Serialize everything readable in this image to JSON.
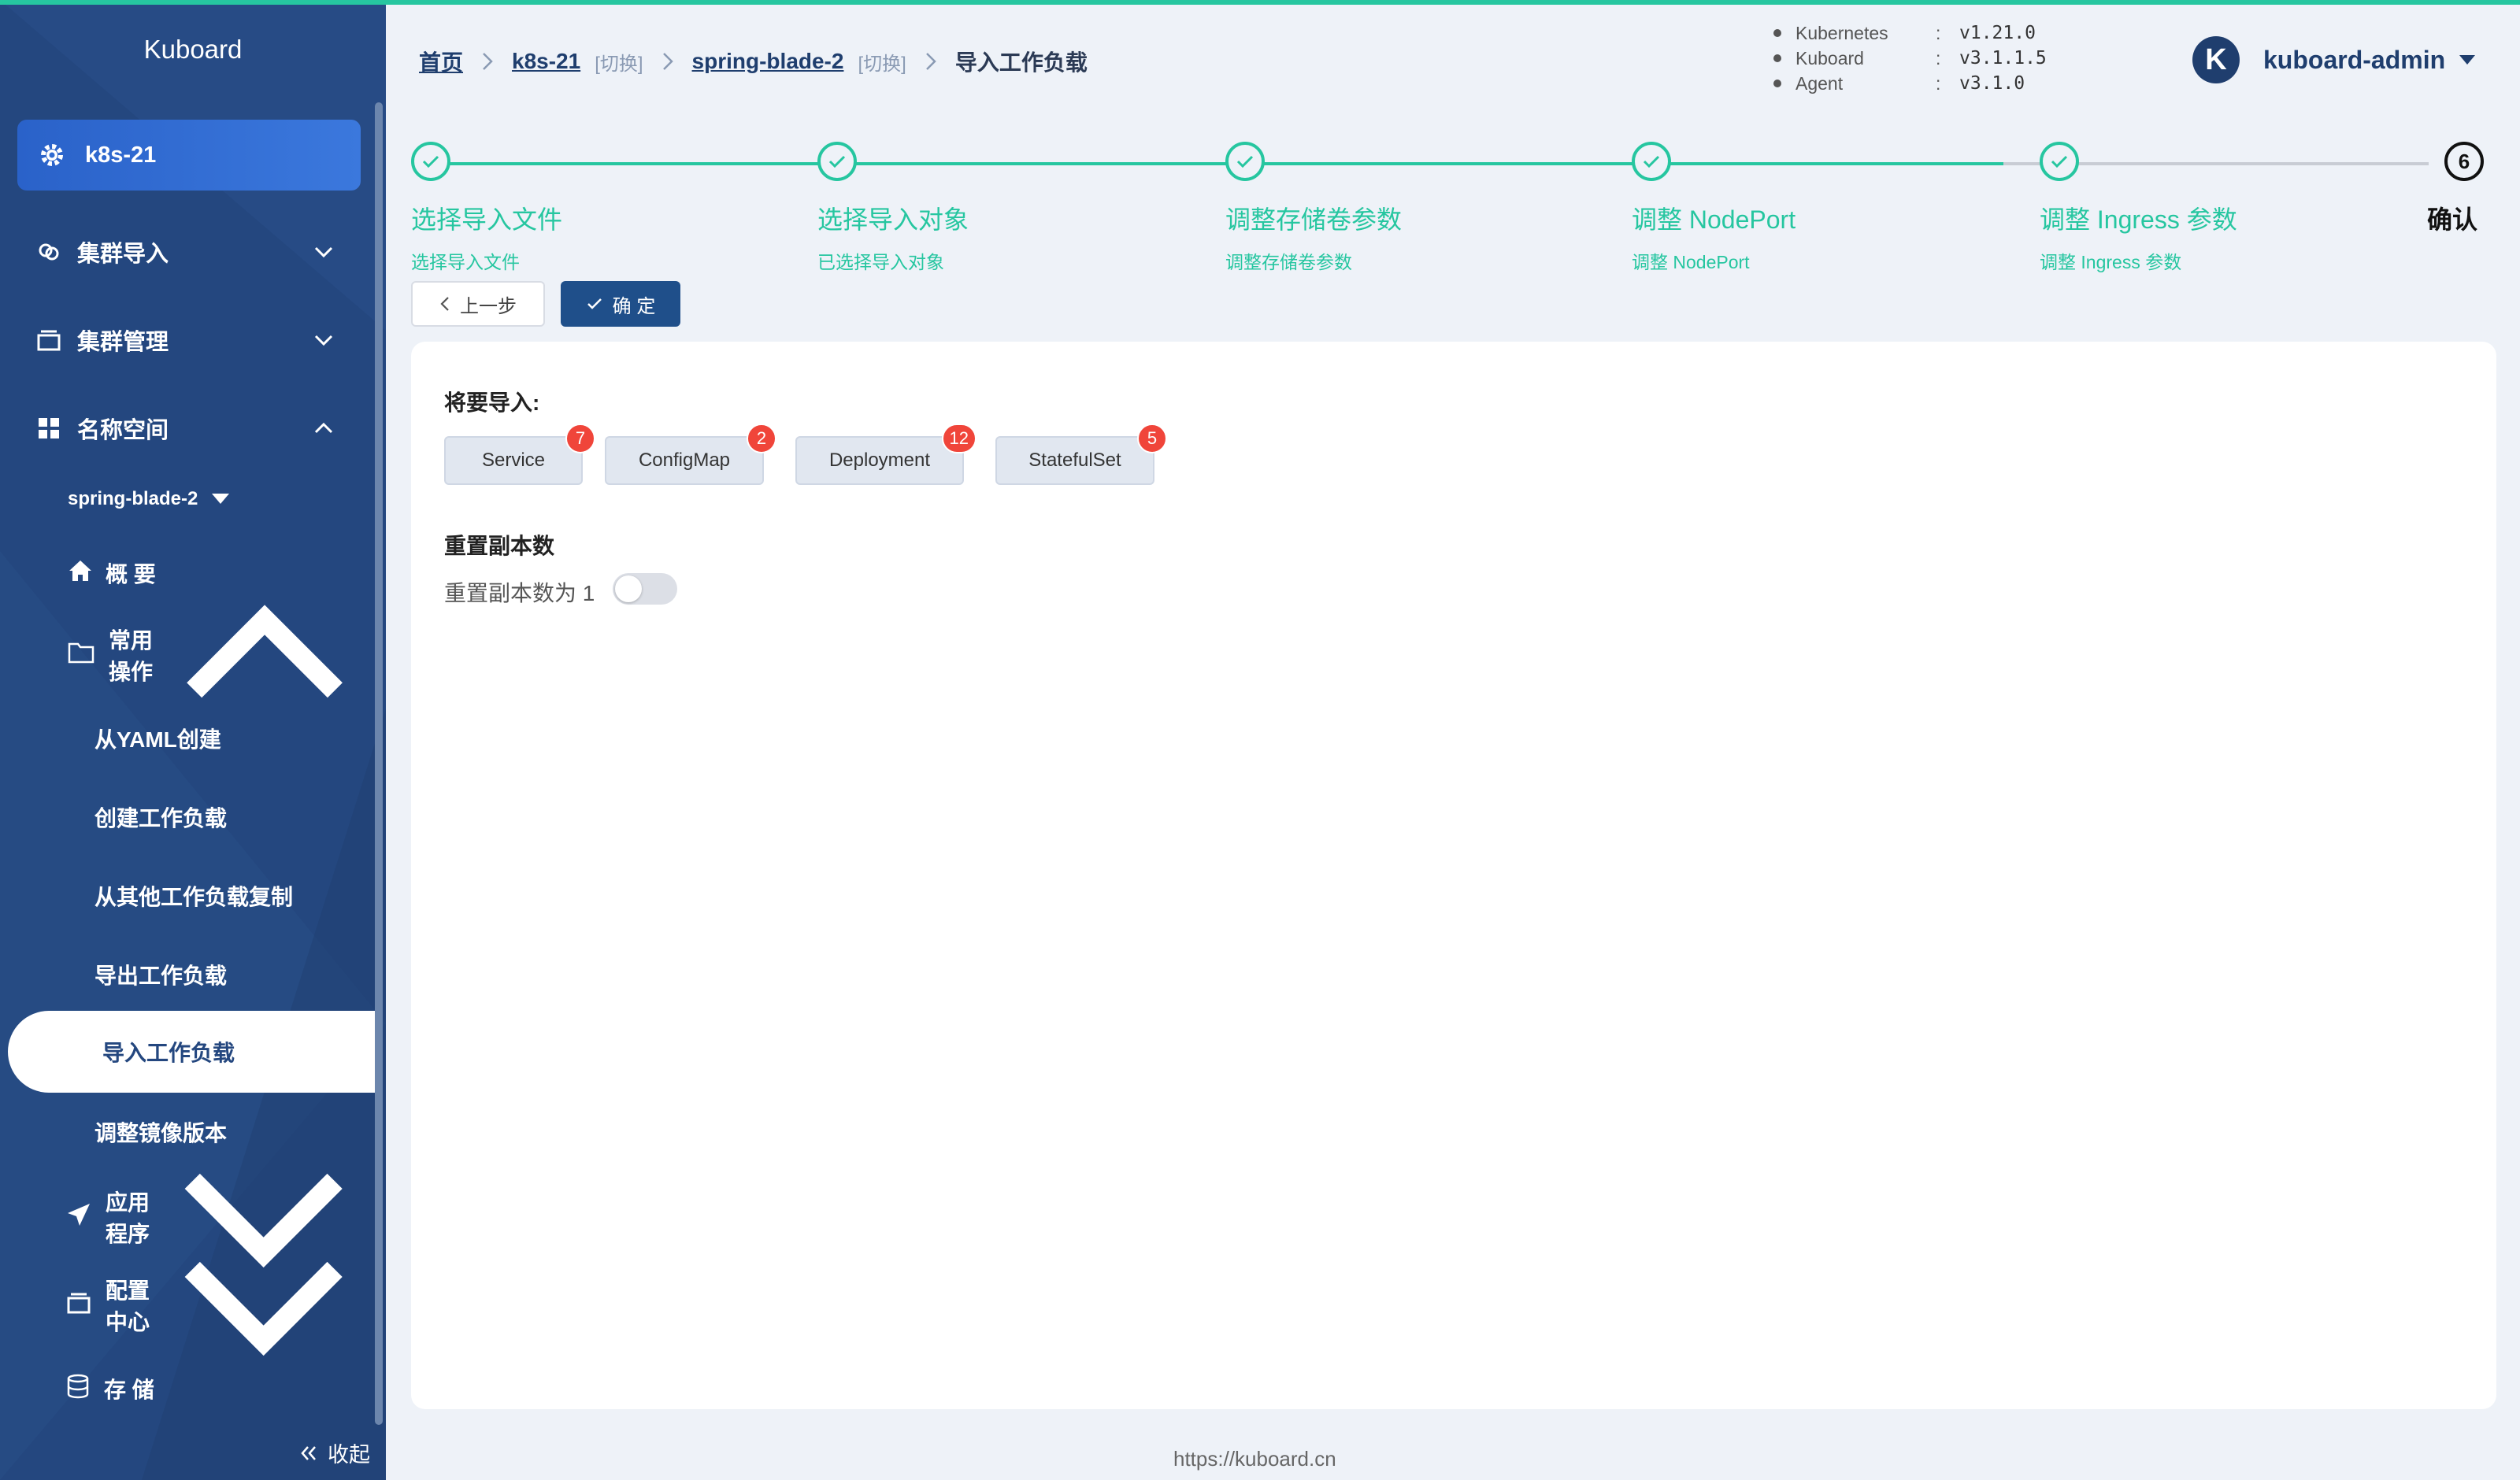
{
  "sidebar": {
    "title": "Kuboard",
    "cluster": "k8s-21",
    "items": [
      {
        "label": "集群导入"
      },
      {
        "label": "集群管理"
      },
      {
        "label": "名称空间"
      }
    ],
    "namespace": "spring-blade-2",
    "overview": "概 要",
    "common_ops": "常用操作",
    "sub_items": [
      {
        "label": "从YAML创建"
      },
      {
        "label": "创建工作负载"
      },
      {
        "label": "从其他工作负载复制"
      },
      {
        "label": "导出工作负载"
      },
      {
        "label": "导入工作负载"
      },
      {
        "label": "调整镜像版本"
      }
    ],
    "apps": "应用程序",
    "config": "配置中心",
    "storage": "存 储",
    "collapse": "收起"
  },
  "breadcrumb": {
    "home": "首页",
    "cluster": "k8s-21",
    "cluster_switch": "[切换]",
    "namespace": "spring-blade-2",
    "namespace_switch": "[切换]",
    "current": "导入工作负载"
  },
  "versions": [
    {
      "name": "Kubernetes",
      "colon": ":",
      "value": "v1.21.0"
    },
    {
      "name": "Kuboard",
      "colon": ":",
      "value": "v3.1.1.5"
    },
    {
      "name": "Agent",
      "colon": ":",
      "value": "v3.1.0"
    }
  ],
  "user": {
    "avatar": "K",
    "name": "kuboard-admin"
  },
  "steps": [
    {
      "title": "选择导入文件",
      "desc": "选择导入文件",
      "status": "done"
    },
    {
      "title": "选择导入对象",
      "desc": "已选择导入对象",
      "status": "done"
    },
    {
      "title": "调整存储卷参数",
      "desc": "调整存储卷参数",
      "status": "done"
    },
    {
      "title": "调整 NodePort",
      "desc": "调整 NodePort",
      "status": "done"
    },
    {
      "title": "调整 Ingress 参数",
      "desc": "调整 Ingress 参数",
      "status": "done"
    },
    {
      "title": "确认",
      "desc": "",
      "number": "6",
      "status": "current"
    }
  ],
  "buttons": {
    "prev": "上一步",
    "confirm": "确 定"
  },
  "panel": {
    "import_label": "将要导入:",
    "tags": [
      {
        "label": "Service",
        "count": "7"
      },
      {
        "label": "ConfigMap",
        "count": "2"
      },
      {
        "label": "Deployment",
        "count": "12"
      },
      {
        "label": "StatefulSet",
        "count": "5"
      }
    ],
    "replica_title": "重置副本数",
    "replica_switch_label": "重置副本数为 1"
  },
  "footer": "https://kuboard.cn",
  "colors": {
    "accent": "#26c6a0",
    "sidebar": "#24477f",
    "primary": "#1f4f8a",
    "badge": "#f0453a"
  }
}
